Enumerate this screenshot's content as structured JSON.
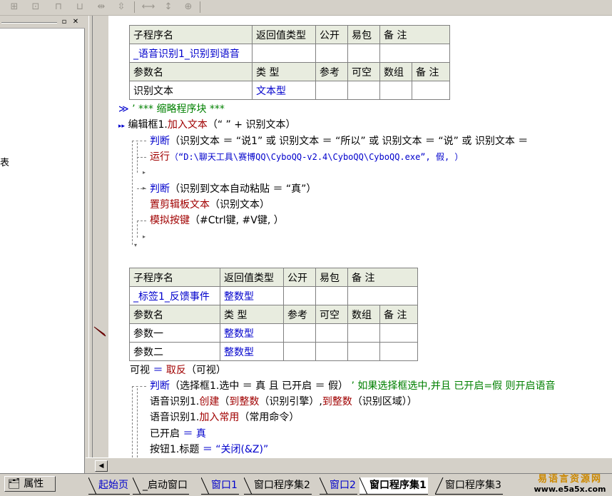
{
  "sub1": {
    "header": [
      "子程序名",
      "返回值类型",
      "公开",
      "易包",
      "备 注"
    ],
    "name": "_语音识别1_识别到语音",
    "param_header": [
      "参数名",
      "类 型",
      "参考",
      "可空",
      "数组",
      "备 注"
    ],
    "params": [
      {
        "name": "识别文本",
        "type": "文本型"
      }
    ]
  },
  "sub2": {
    "header": [
      "子程序名",
      "返回值类型",
      "公开",
      "易包",
      "备 注"
    ],
    "name": "_标签1_反馈事件",
    "return_type": "整数型",
    "param_header": [
      "参数名",
      "类 型",
      "参考",
      "可空",
      "数组",
      "备 注"
    ],
    "params": [
      {
        "name": "参数一",
        "type": "整数型"
      },
      {
        "name": "参数二",
        "type": "整数型"
      }
    ]
  },
  "code1": {
    "l1_marker": "≫",
    "l1_text": "’ *** 缩略程序块 ***",
    "l2_marker": "▸▸",
    "l2_a": "编辑框1.",
    "l2_b": "加入文本",
    "l2_c": "（“ ” + 识别文本）",
    "l3_kw": "判断",
    "l3_text": "（识别文本 ＝ “说1” 或 识别文本 ＝ “所以” 或 识别文本 ＝ “说” 或 识别文本 ＝",
    "l4_kw": "运行",
    "l4_text": "（“D:\\聊天工具\\赛博QQ\\CyboQQ-v2.4\\CyboQQ\\CyboQQ.exe”, 假, ）",
    "l5_kw": "判断",
    "l5_text": "（识别到文本自动粘贴 ＝ “真”）",
    "l6_kw": "置剪辑板文本",
    "l6_text": "（识别文本）",
    "l7_kw": "模拟按键",
    "l7_text": "（#Ctrl键, #V键, ）"
  },
  "code2": {
    "c1_a": "可视",
    "c1_b": "＝",
    "c1_c": "取反",
    "c1_d": "（可视）",
    "c2_kw": "判断",
    "c2_text": "（选择框1.选中 ＝ 真 且 已开启 ＝ 假）",
    "c2_comment": "’ 如果选择框选中,并且 已开启=假 则开启语音",
    "c3_a": "语音识别1.",
    "c3_b": "创建",
    "c3_c": "（",
    "c3_d": "到整数",
    "c3_e": "（识别引擎）,",
    "c3_f": "到整数",
    "c3_g": "（识别区域））",
    "c4_a": "语音识别1.",
    "c4_b": "加入常用",
    "c4_c": "（常用命令）",
    "c5_a": "已开启",
    "c5_b": "＝ 真",
    "c6_a": "按钮1.标题",
    "c6_b": "＝ “关闭(&Z)”"
  },
  "left_panel": {
    "stub": "表"
  },
  "bottom": {
    "props": "属性",
    "tabs": [
      "起始页",
      "_启动窗口",
      "窗口1",
      "窗口程序集2",
      "窗口2",
      "窗口程序集1",
      "窗口程序集3"
    ],
    "active_tab": "窗口程序集1",
    "logo_top": "易语言资源网",
    "logo_bottom": "www.e5a5x.com"
  },
  "colors": {
    "link": "#0000cc",
    "keyword": "#a00000",
    "comment": "#008000",
    "header_bg": "#e8ecdf"
  }
}
